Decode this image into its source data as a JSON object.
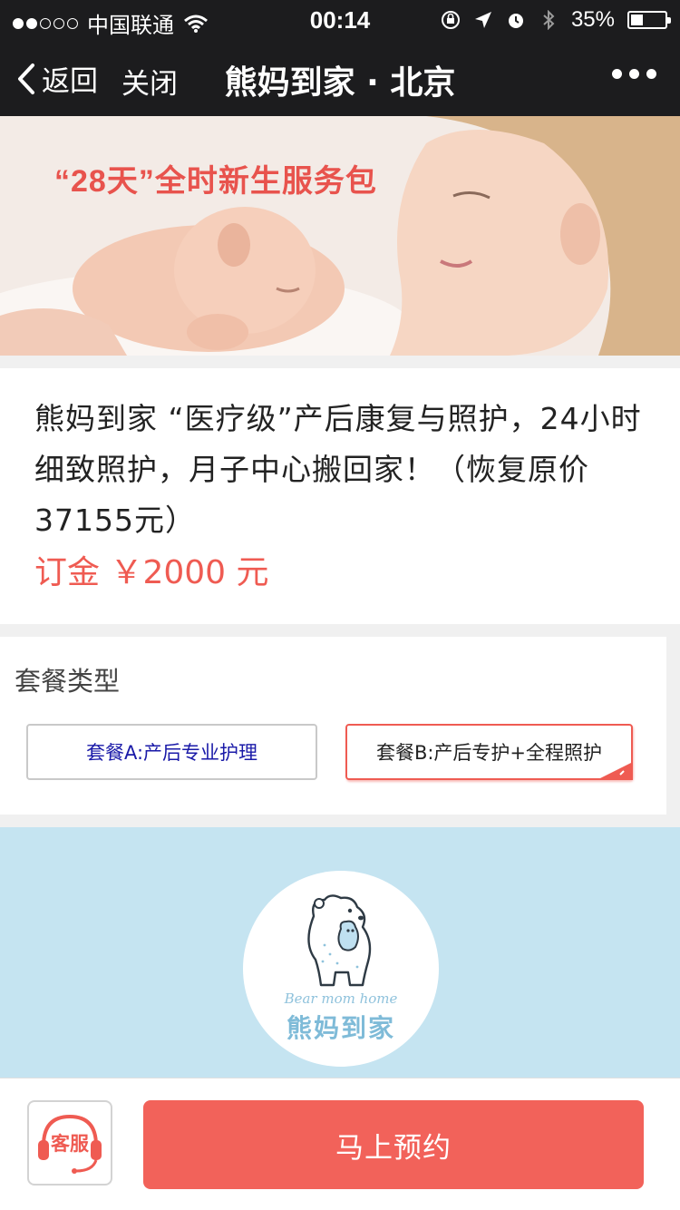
{
  "status_bar": {
    "carrier": "中国联通",
    "time": "00:14",
    "battery_percent": "35%",
    "battery_level": 0.35
  },
  "nav": {
    "back_label": "返回",
    "close_label": "关闭",
    "title": "熊妈到家 · 北京"
  },
  "banner": {
    "headline": "“28天”全时新生服务包"
  },
  "product": {
    "title": "熊妈到家 “医疗级”产后康复与照护，24小时细致照护，月子中心搬回家！（恢复原价37155元）",
    "price": "订金 ￥2000 元"
  },
  "package": {
    "section_title": "套餐类型",
    "options": [
      {
        "label": "套餐A:产后专业护理",
        "selected": false
      },
      {
        "label": "套餐B:产后专护+全程照护",
        "selected": true
      }
    ]
  },
  "promo": {
    "logo_en": "Bear mom home",
    "logo_cn": "熊妈到家"
  },
  "bottom_bar": {
    "service_label": "客服",
    "book_label": "马上预约"
  },
  "colors": {
    "accent": "#f2625a",
    "price": "#ef5b52",
    "nav_bg": "#1c1c1e",
    "promo_bg": "#c5e4f1"
  }
}
